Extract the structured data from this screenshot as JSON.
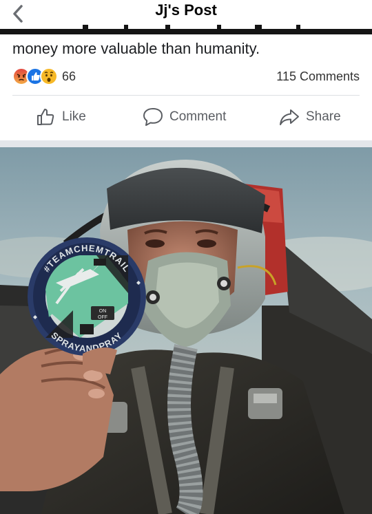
{
  "header": {
    "title": "Jj's Post",
    "back_icon": "chevron-left-icon"
  },
  "post": {
    "text": "money more valuable than humanity.",
    "reactions": {
      "icons": [
        "angry-icon",
        "like-icon",
        "wow-icon"
      ],
      "count": "66"
    },
    "comments_label": "115 Comments"
  },
  "actions": {
    "like_label": "Like",
    "comment_label": "Comment",
    "share_label": "Share"
  },
  "photo": {
    "patch_top_text": "#TEAMCHEMTRAIL",
    "patch_bottom_text": "SPRAYANDPRAY",
    "switch_on": "ON",
    "switch_off": "OFF"
  },
  "colors": {
    "accent": "#1b74e4",
    "text": "#1c1e21",
    "muted": "#5a5d62",
    "divider": "#e4e6ea"
  }
}
